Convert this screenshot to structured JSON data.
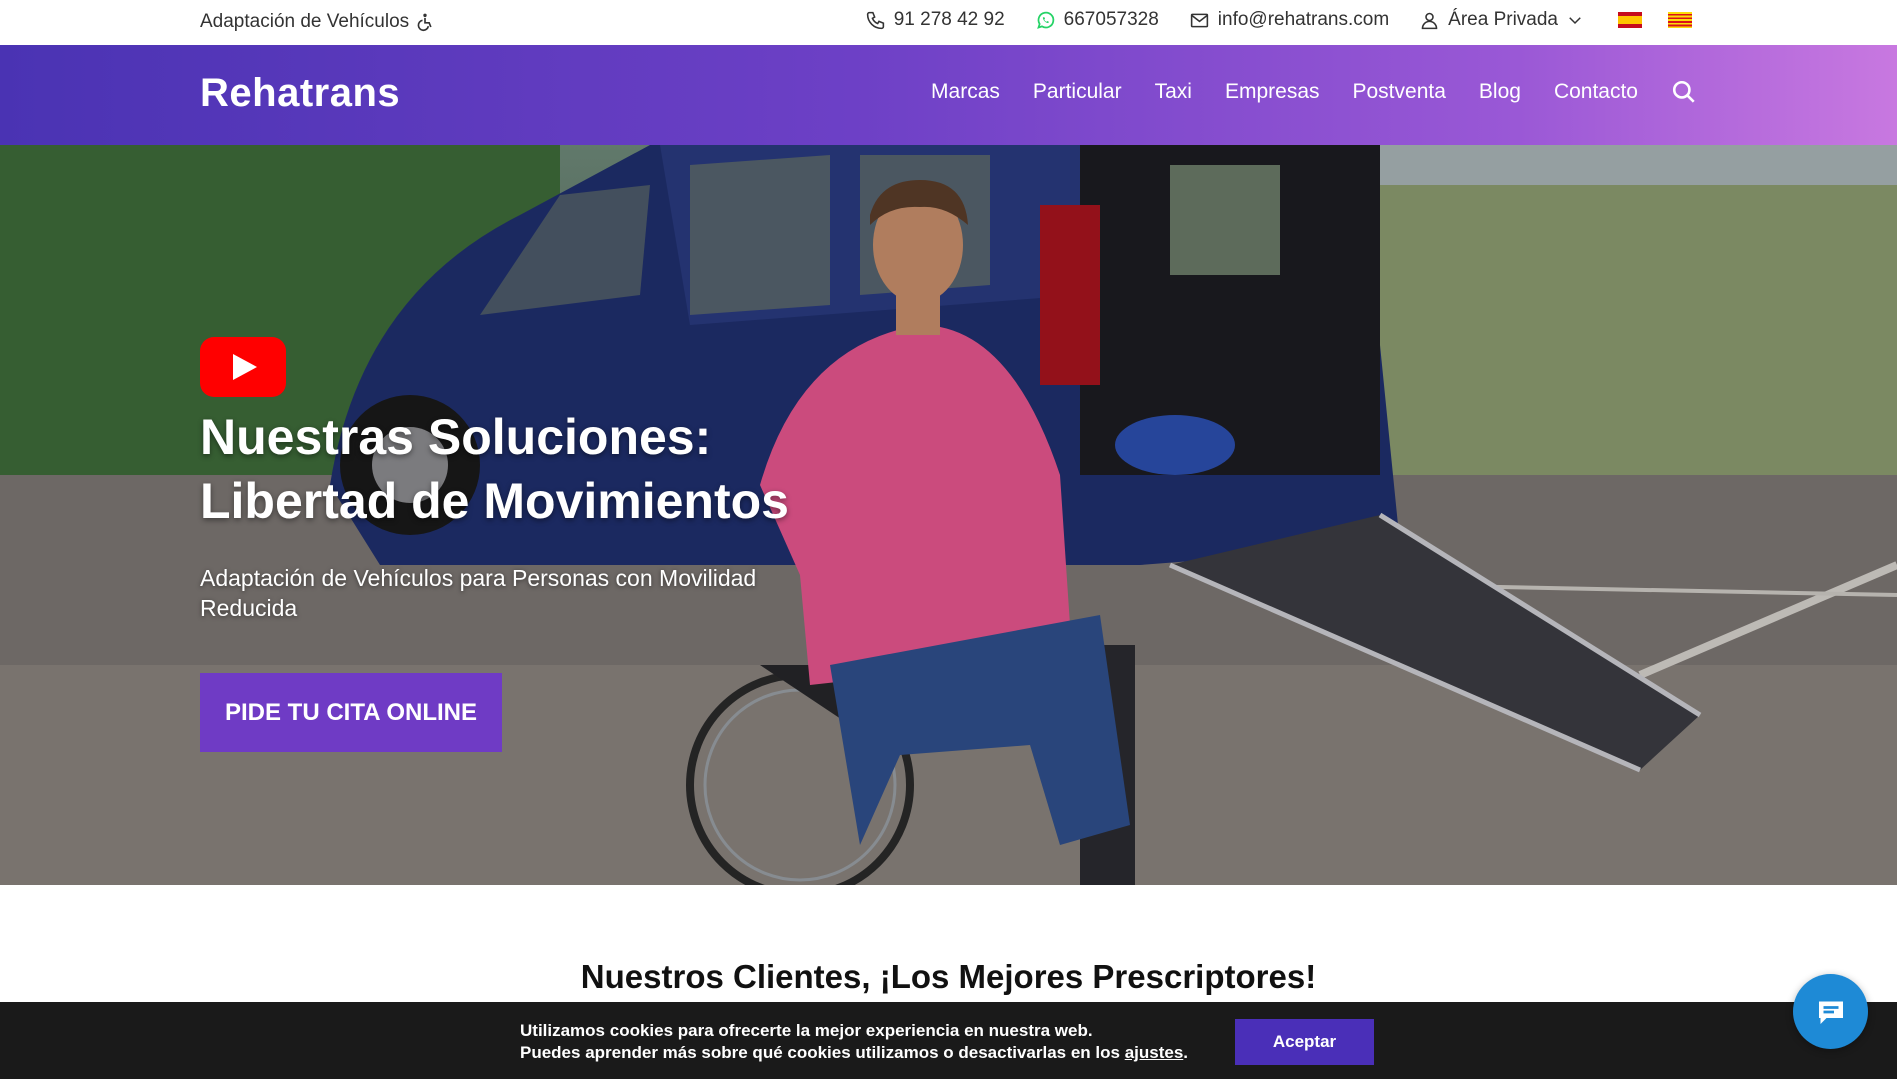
{
  "topbar": {
    "tagline": "Adaptación de Vehículos",
    "phone": "91 278 42 92",
    "whatsapp": "667057328",
    "email": "info@rehatrans.com",
    "private_area": "Área Privada"
  },
  "nav": {
    "logo": "Rehatrans",
    "items": [
      "Marcas",
      "Particular",
      "Taxi",
      "Empresas",
      "Postventa",
      "Blog",
      "Contacto"
    ]
  },
  "hero": {
    "title_line1": "Nuestras Soluciones:",
    "title_line2": "Libertad de Movimientos",
    "subtitle": "Adaptación de Vehículos para Personas con Movilidad Reducida",
    "cta": "PIDE TU CITA ONLINE"
  },
  "clients": {
    "title": "Nuestros Clientes, ¡Los Mejores Prescriptores!"
  },
  "cookie": {
    "line1": "Utilizamos cookies para ofrecerte la mejor experiencia en nuestra web.",
    "line2_prefix": "Puedes aprender más sobre qué cookies utilizamos o desactivarlas en los",
    "line2_link": "ajustes",
    "accept": "Aceptar"
  },
  "colors": {
    "nav_gradient_start": "#4a33b3",
    "nav_gradient_end": "#c878e0",
    "cta_bg": "#6f3bc5",
    "accept_bg": "#4a2fb8",
    "chat_bg": "#1e8ad6",
    "youtube_red": "#ff0000"
  },
  "icons": {
    "tagline": "wheelchair-icon",
    "phone": "phone-icon",
    "whatsapp": "whatsapp-icon",
    "email": "envelope-icon",
    "user": "user-icon",
    "dropdown": "chevron-down-icon",
    "search": "search-icon",
    "chat": "chat-icon",
    "video": "youtube-play-icon"
  }
}
